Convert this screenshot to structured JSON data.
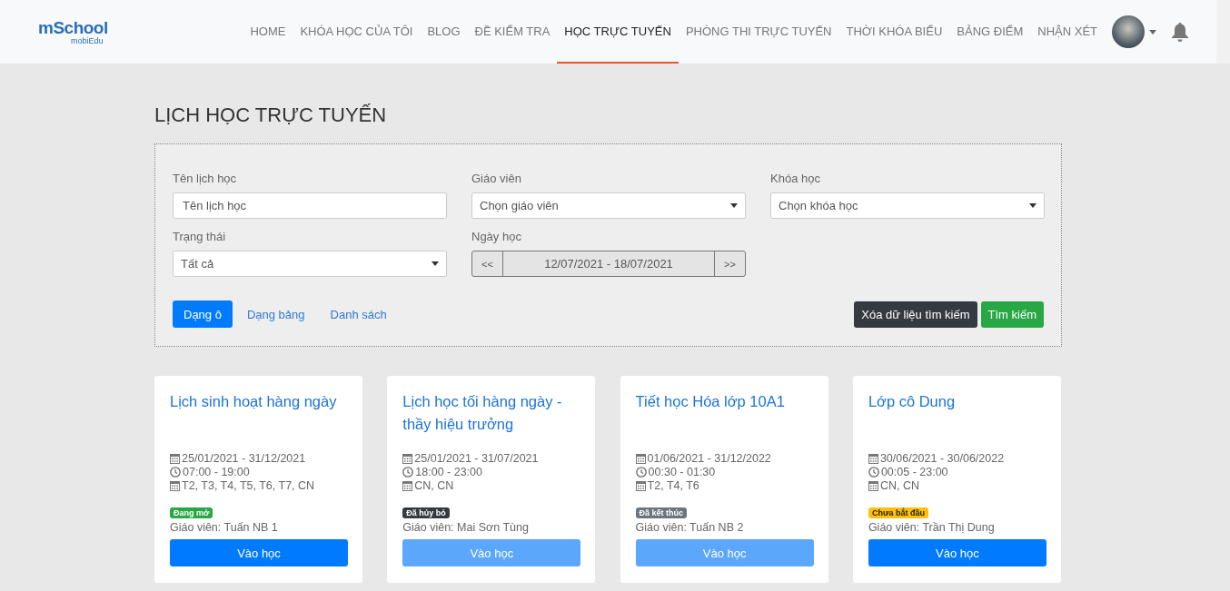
{
  "logo": {
    "name": "mSchool",
    "tagline": "mobiEdu"
  },
  "nav": [
    {
      "label": "HOME",
      "selected": false
    },
    {
      "label": "KHÓA HỌC CỦA TÔI",
      "selected": false
    },
    {
      "label": "BLOG",
      "selected": false
    },
    {
      "label": "ĐỀ KIỂM TRA",
      "selected": false
    },
    {
      "label": "HỌC TRỰC TUYẾN",
      "selected": true
    },
    {
      "label": "PHÒNG THI TRỰC TUYẾN",
      "selected": false
    },
    {
      "label": "THỜI KHÓA BIỂU",
      "selected": false
    },
    {
      "label": "BẢNG ĐIỂM",
      "selected": false
    },
    {
      "label": "NHẬN XÉT",
      "selected": false
    }
  ],
  "page_title": "LỊCH HỌC TRỰC TUYẾN",
  "filters": {
    "name": {
      "label": "Tên lịch học",
      "placeholder": "Tên lịch học"
    },
    "teacher": {
      "label": "Giáo viên",
      "value": "Chọn giáo viên"
    },
    "course": {
      "label": "Khóa học",
      "value": "Chọn khóa học"
    },
    "status": {
      "label": "Trạng thái",
      "value": "Tất cả"
    },
    "date": {
      "label": "Ngày học",
      "prev": "<<",
      "range": "12/07/2021 - 18/07/2021",
      "next": ">>"
    }
  },
  "views": [
    {
      "label": "Dạng ô",
      "selected": true
    },
    {
      "label": "Dạng bảng",
      "selected": false
    },
    {
      "label": "Danh sách",
      "selected": false
    }
  ],
  "clear_button": "Xóa dữ liệu tìm kiếm",
  "search_button": "Tìm kiếm",
  "cards": [
    {
      "title": "Lịch sinh hoạt hàng ngày",
      "dates": "25/01/2021 - 31/12/2021",
      "time": "07:00 - 19:00",
      "days": "T2, T3, T4, T5, T6, T7, CN",
      "status": {
        "kind": "open",
        "label": "Đang mở"
      },
      "teacher": "Giáo viên: Tuấn NB 1",
      "button": "Vào học",
      "disabled": false
    },
    {
      "title": "Lịch học tối hàng ngày - thầy hiệu trưởng",
      "dates": "25/01/2021 - 31/07/2021",
      "time": "18:00 - 23:00",
      "days": "CN, CN",
      "status": {
        "kind": "cancelled",
        "label": "Đã hủy bỏ"
      },
      "teacher": "Giáo viên: Mai Sơn Tùng",
      "button": "Vào học",
      "disabled": true
    },
    {
      "title": "Tiết học Hóa lớp 10A1",
      "dates": "01/06/2021 - 31/12/2022",
      "time": "00:30 - 01:30",
      "days": "T2, T4, T6",
      "status": {
        "kind": "ended",
        "label": "Đã kết thúc"
      },
      "teacher": "Giáo viên: Tuấn NB 2",
      "button": "Vào học",
      "disabled": true
    },
    {
      "title": "Lớp cô Dung",
      "dates": "30/06/2021 - 30/06/2022",
      "time": "00:05 - 23:00",
      "days": "CN, CN",
      "status": {
        "kind": "upcoming",
        "label": "Chưa bắt đầu"
      },
      "teacher": "Giáo viên: Trần Thị Dung",
      "button": "Vào học",
      "disabled": false
    }
  ]
}
